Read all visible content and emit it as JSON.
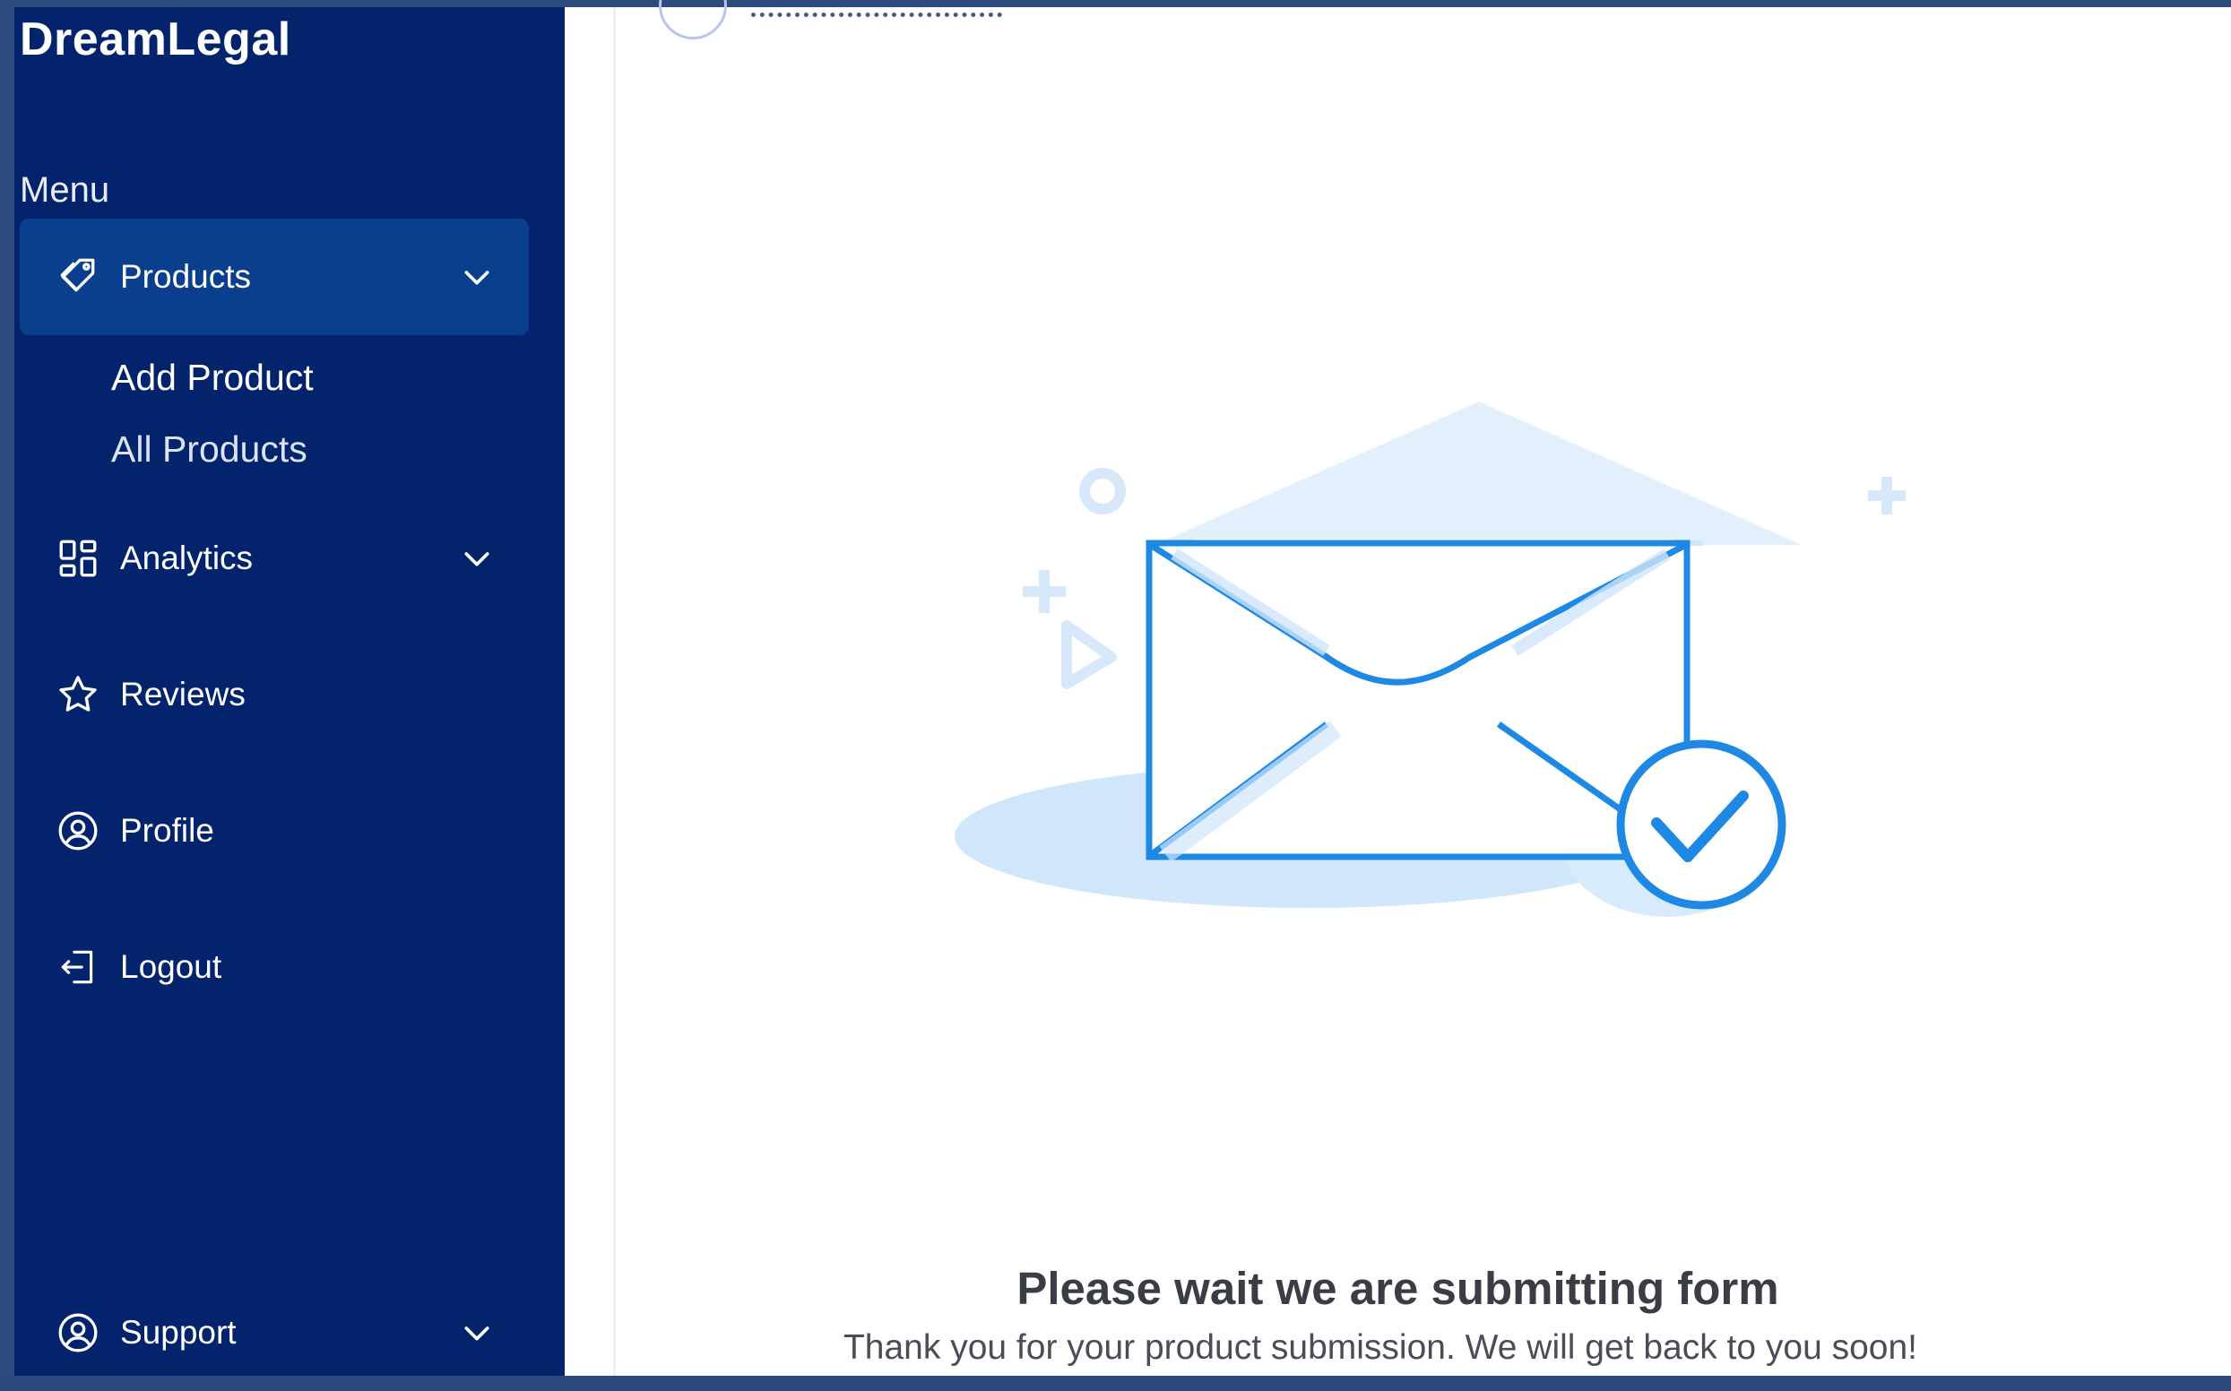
{
  "brand": "DreamLegal",
  "sidebar": {
    "menu_heading": "Menu",
    "items": [
      {
        "label": "Products",
        "icon": "tag-icon",
        "active": true
      },
      {
        "label": "Analytics",
        "icon": "grid-icon"
      },
      {
        "label": "Reviews",
        "icon": "star-icon"
      },
      {
        "label": "Profile",
        "icon": "user-circle-icon"
      },
      {
        "label": "Logout",
        "icon": "logout-icon"
      },
      {
        "label": "Support",
        "icon": "support-icon"
      }
    ],
    "products_sub": [
      "Add Product",
      "All Products"
    ]
  },
  "status": {
    "title": "Please wait we are submitting form",
    "subtitle": "Thank you for your product submission. We will get back to you soon!"
  },
  "colors": {
    "sidebar_bg": "#03246d",
    "active_bg": "#0a3f8e",
    "accent": "#1e88e5",
    "light_accent": "#cfe6fb"
  }
}
